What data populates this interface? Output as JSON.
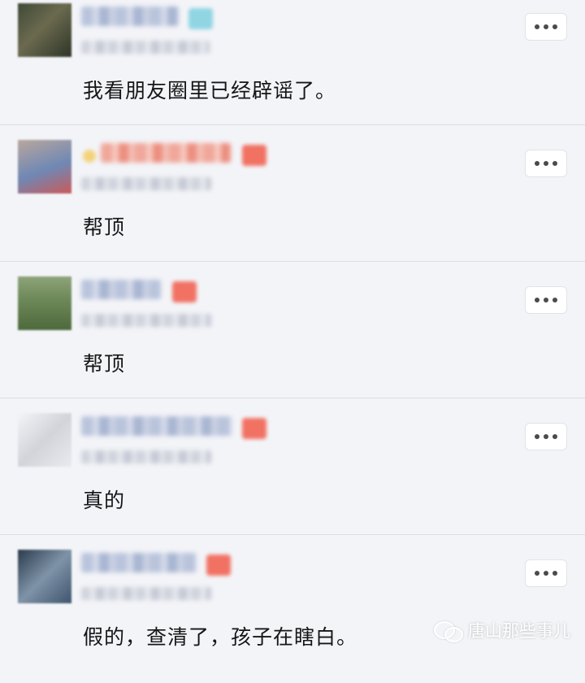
{
  "comments": [
    {
      "text": "我看朋友圈里已经辟谣了。",
      "badge_color": "#8fd5e2",
      "avatar_colors": [
        "#3f4a36",
        "#6b6a4f",
        "#2d3527"
      ]
    },
    {
      "text": "帮顶",
      "badge_color": "#f17163",
      "avatar_colors": [
        "#b9a79c",
        "#6f88b5",
        "#c95a5a"
      ]
    },
    {
      "text": "帮顶",
      "badge_color": "#f17163",
      "avatar_colors": [
        "#6f8a5a",
        "#4d6a3c",
        "#8ea37a"
      ]
    },
    {
      "text": "真的",
      "badge_color": "#f17163",
      "avatar_colors": [
        "#e9eaee",
        "#d2d4da",
        "#f4f4f6"
      ]
    },
    {
      "text": "假的，查清了，孩子在瞎白。",
      "badge_color": "#f17163",
      "avatar_colors": [
        "#3e556e",
        "#7f93a8",
        "#2b3b4d"
      ]
    }
  ],
  "more_icon": "ellipsis-icon",
  "watermark": {
    "icon": "wechat-icon",
    "text": "唐山那些事儿"
  },
  "colors": {
    "background": "#f3f4f8",
    "divider": "#dcdde3",
    "text": "#161616"
  }
}
